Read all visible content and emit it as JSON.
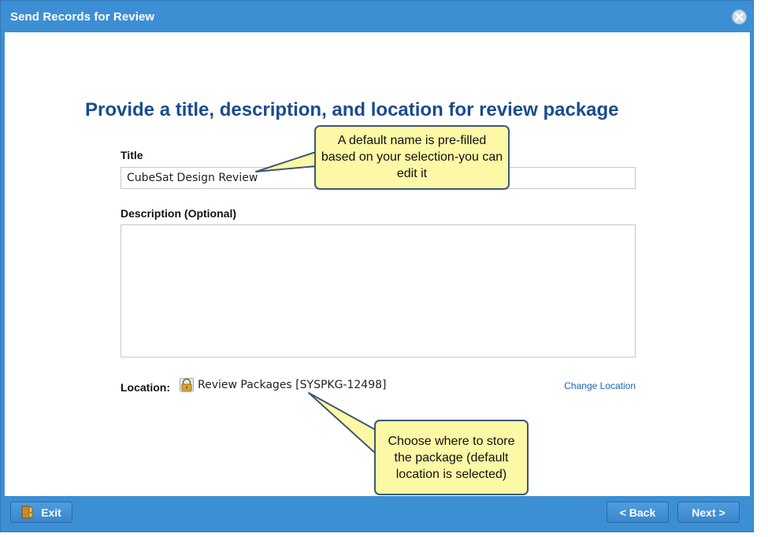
{
  "window": {
    "title": "Send Records for Review",
    "close_icon": "close-icon"
  },
  "main": {
    "heading": "Provide a title, description, and location for review package",
    "title_label": "Title",
    "title_value": "CubeSat Design Review",
    "description_label": "Description (Optional)",
    "description_value": "",
    "location_label": "Location:",
    "location_icon": "folder-lock-icon",
    "location_value": "Review Packages [SYSPKG-12498]",
    "change_location_link": "Change Location"
  },
  "callouts": {
    "title_hint": "A default name is pre-filled based on your selection-you can edit it",
    "location_hint": "Choose where to store the package (default location is selected)"
  },
  "footer": {
    "exit_label": "Exit",
    "exit_icon": "exit-door-icon",
    "back_label": "< Back",
    "next_label": "Next >"
  },
  "colors": {
    "frame": "#3d8fd4",
    "heading": "#1a4c8c",
    "link": "#1a64b4",
    "callout_fill": "#fdf8a6",
    "callout_border": "#3e5774"
  }
}
